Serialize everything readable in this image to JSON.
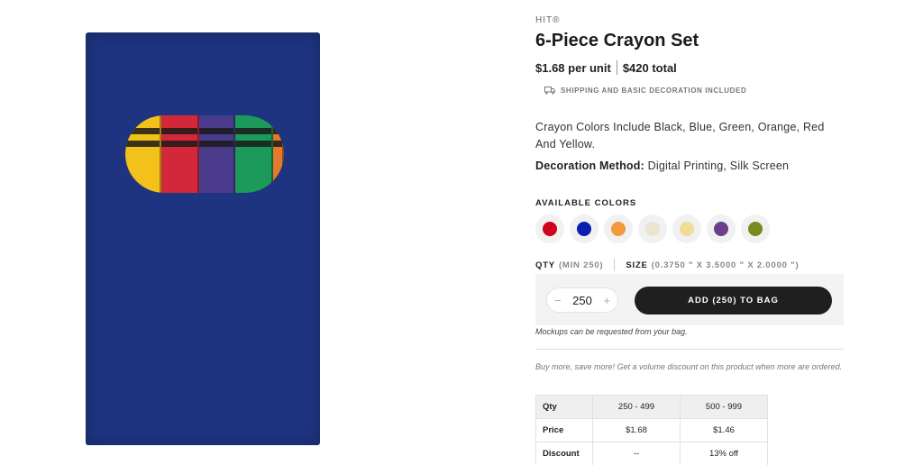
{
  "product": {
    "brand": "HIT®",
    "title": "6-Piece Crayon Set",
    "price_unit": "$1.68 per unit",
    "price_total": "$420 total",
    "shipping": "SHIPPING AND BASIC DECORATION INCLUDED",
    "description": "Crayon Colors Include Black, Blue, Green, Orange, Red And Yellow.",
    "decoration_label": "Decoration Method:",
    "decoration_value": " Digital Printing, Silk Screen"
  },
  "image": {
    "box_color": "#1e3480",
    "crayons": [
      "#f2c21b",
      "#d3283a",
      "#4a3a8c",
      "#1b9a5a",
      "#e3792b"
    ]
  },
  "colors": {
    "label": "AVAILABLE COLORS",
    "swatches": [
      "#d0021b",
      "#0a1fb0",
      "#f19a3e",
      "#ece3d3",
      "#f0dc96",
      "#6b3f8a",
      "#7a8a1e"
    ]
  },
  "order": {
    "qty_label": "QTY",
    "qty_min": "(MIN 250)",
    "size_label": "SIZE",
    "size_value": "(0.3750 \" X 3.5000 \" X 2.0000 \")",
    "minus": "−",
    "plus": "+",
    "quantity": "250",
    "add_button": "ADD (250) TO BAG",
    "mockup_note": "Mockups can be requested from your bag.",
    "volume_note": "Buy more, save more! Get a volume discount on this product when more are ordered."
  },
  "pricing_table": {
    "rows": [
      [
        "Qty",
        "250 - 499",
        "500 - 999"
      ],
      [
        "Price",
        "$1.68",
        "$1.46"
      ],
      [
        "Discount",
        "--",
        "13% off"
      ]
    ]
  }
}
